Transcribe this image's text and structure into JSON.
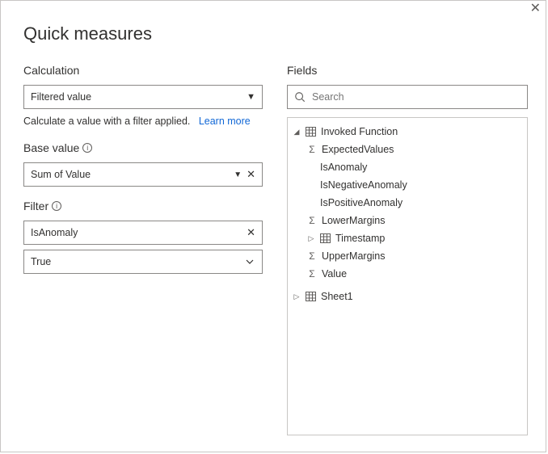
{
  "dialog": {
    "title": "Quick measures"
  },
  "calculation": {
    "label": "Calculation",
    "selected": "Filtered value",
    "description": "Calculate a value with a filter applied.",
    "learn_more": "Learn more"
  },
  "base_value": {
    "label": "Base value",
    "value": "Sum of Value"
  },
  "filter": {
    "label": "Filter",
    "field": "IsAnomaly",
    "value": "True"
  },
  "fields": {
    "label": "Fields",
    "search_placeholder": "Search",
    "tree": {
      "table1": {
        "name": "Invoked Function",
        "items": [
          {
            "label": "ExpectedValues",
            "kind": "sigma"
          },
          {
            "label": "IsAnomaly",
            "kind": "none"
          },
          {
            "label": "IsNegativeAnomaly",
            "kind": "none"
          },
          {
            "label": "IsPositiveAnomaly",
            "kind": "none"
          },
          {
            "label": "LowerMargins",
            "kind": "sigma"
          },
          {
            "label": "Timestamp",
            "kind": "table-collapsed"
          },
          {
            "label": "UpperMargins",
            "kind": "sigma"
          },
          {
            "label": "Value",
            "kind": "sigma"
          }
        ]
      },
      "table2": {
        "name": "Sheet1"
      }
    }
  }
}
